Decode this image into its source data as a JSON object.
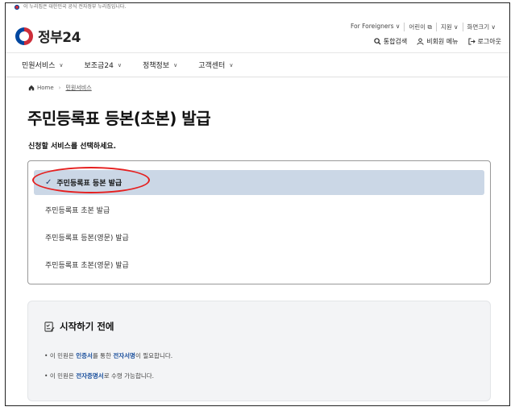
{
  "gov_banner": {
    "text": "이 누리집은 대한민국 공식 전자정부 누리집입니다."
  },
  "header": {
    "logo_text": "정부24",
    "util_links": [
      "For Foreigners ∨",
      "어린이 ⧉",
      "지원 ∨",
      "화면크기 ∨"
    ],
    "actions": [
      {
        "label": "통합검색",
        "icon": "search-icon"
      },
      {
        "label": "비회원 메뉴",
        "icon": "user-icon"
      },
      {
        "label": "로그아웃",
        "icon": "logout-icon"
      }
    ]
  },
  "nav": {
    "items": [
      "민원서비스",
      "보조금24",
      "정책정보",
      "고객센터"
    ]
  },
  "breadcrumb": {
    "home": "Home",
    "current": "민원서비스"
  },
  "page": {
    "title": "주민등록표 등본(초본) 발급",
    "instruction": "신청할 서비스를 선택하세요."
  },
  "options": {
    "selected_index": 0,
    "items": [
      "주민등록표 등본 발급",
      "주민등록표 초본 발급",
      "주민등록표 등본(영문) 발급",
      "주민등록표 초본(영문) 발급"
    ]
  },
  "before_start": {
    "title": "시작하기 전에",
    "bullet1": {
      "pre": "이 민원은 ",
      "em1": "인증서",
      "mid": "를 통한 ",
      "em2": "전자서명",
      "post": "이 필요합니다."
    },
    "bullet2": {
      "pre": "이 민원은 ",
      "em1": "전자증명서",
      "post": "로 수령 가능합니다."
    }
  },
  "colors": {
    "selected_bg": "#cbd7e6",
    "highlight": "#e51f1f",
    "accent": "#1a4f9c"
  }
}
